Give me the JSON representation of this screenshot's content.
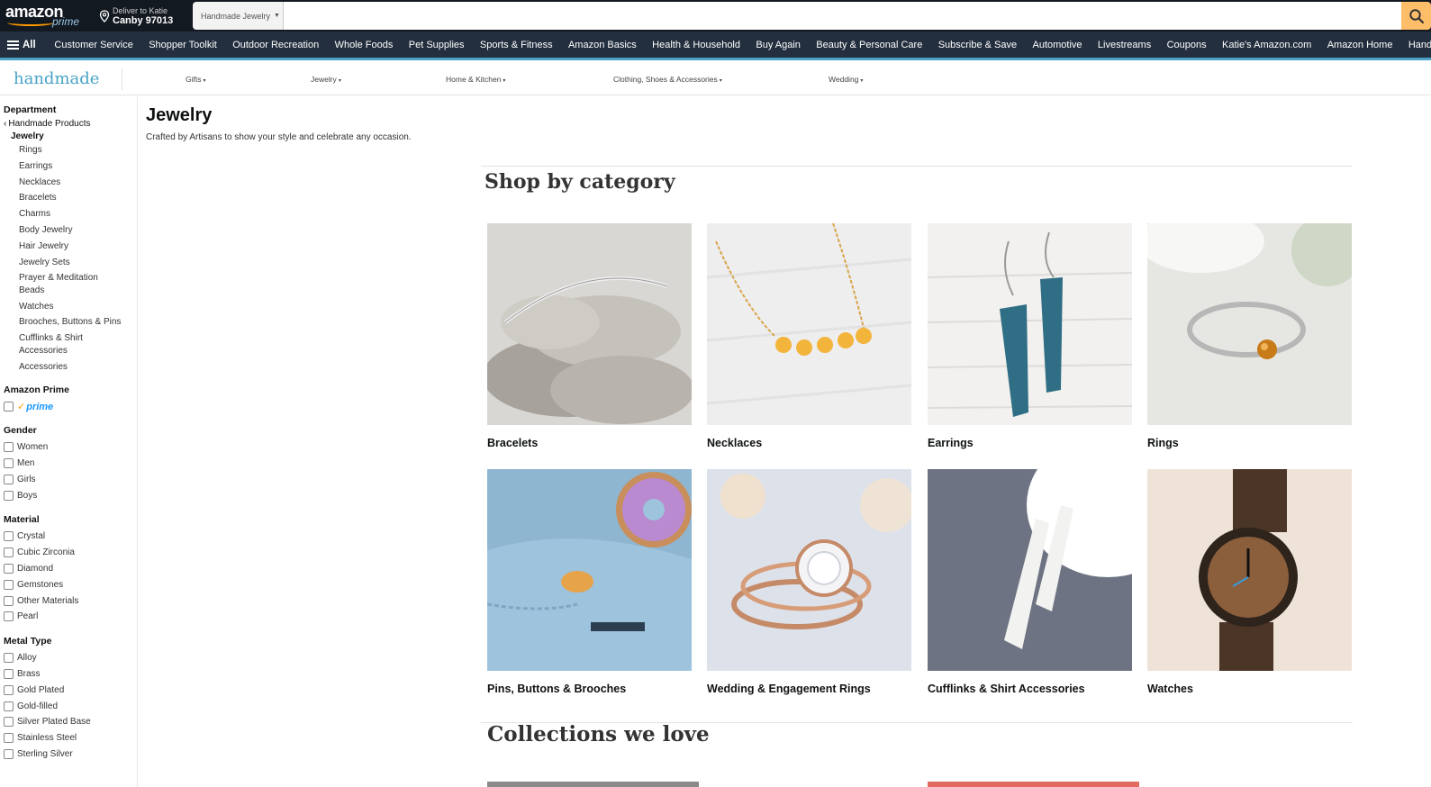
{
  "header": {
    "logo_text": "amazon",
    "logo_sub": "prime",
    "deliver_line1": "Deliver to Katie",
    "deliver_line2": "Canby 97013",
    "search_department": "Handmade Jewelry",
    "search_placeholder": ""
  },
  "nav": {
    "all_label": "All",
    "items": [
      "Customer Service",
      "Shopper Toolkit",
      "Outdoor Recreation",
      "Whole Foods",
      "Pet Supplies",
      "Sports & Fitness",
      "Amazon Basics",
      "Health & Household",
      "Buy Again",
      "Beauty & Personal Care",
      "Subscribe & Save",
      "Automotive",
      "Livestreams",
      "Coupons",
      "Katie's Amazon.com",
      "Amazon Home",
      "Handmade"
    ]
  },
  "handmade_nav": {
    "logo": "handmade",
    "categories": [
      "Gifts",
      "Jewelry",
      "Home & Kitchen",
      "Clothing, Shoes & Accessories",
      "Wedding"
    ]
  },
  "sidebar": {
    "department_heading": "Department",
    "back_link": "Handmade Products",
    "current": "Jewelry",
    "links": [
      "Rings",
      "Earrings",
      "Necklaces",
      "Bracelets",
      "Charms",
      "Body Jewelry",
      "Hair Jewelry",
      "Jewelry Sets",
      "Prayer & Meditation Beads",
      "Watches",
      "Brooches, Buttons & Pins",
      "Cufflinks & Shirt Accessories",
      "Accessories"
    ],
    "prime_heading": "Amazon Prime",
    "prime_label": "prime",
    "gender_heading": "Gender",
    "gender": [
      "Women",
      "Men",
      "Girls",
      "Boys"
    ],
    "material_heading": "Material",
    "material": [
      "Crystal",
      "Cubic Zirconia",
      "Diamond",
      "Gemstones",
      "Other Materials",
      "Pearl"
    ],
    "metal_heading": "Metal Type",
    "metal": [
      "Alloy",
      "Brass",
      "Gold Plated",
      "Gold-filled",
      "Silver Plated Base",
      "Stainless Steel",
      "Sterling Silver"
    ]
  },
  "main": {
    "title": "Jewelry",
    "subtitle": "Crafted by Artisans to show your style and celebrate any occasion.",
    "shop_heading": "Shop by category",
    "categories": [
      "Bracelets",
      "Necklaces",
      "Earrings",
      "Rings",
      "Pins, Buttons & Brooches",
      "Wedding & Engagement Rings",
      "Cufflinks & Shirt Accessories",
      "Watches"
    ],
    "collections_heading": "Collections we love"
  },
  "colors": {
    "topbar": "#131921",
    "navbar": "#232f3e",
    "accent": "#ff9900",
    "handmade_teal": "#48a3c6",
    "search_button": "#febd69"
  },
  "icons": [
    "location-pin-icon",
    "search-icon",
    "hamburger-menu-icon",
    "chevron-down-icon",
    "chevron-left-icon",
    "checkbox-icon"
  ]
}
